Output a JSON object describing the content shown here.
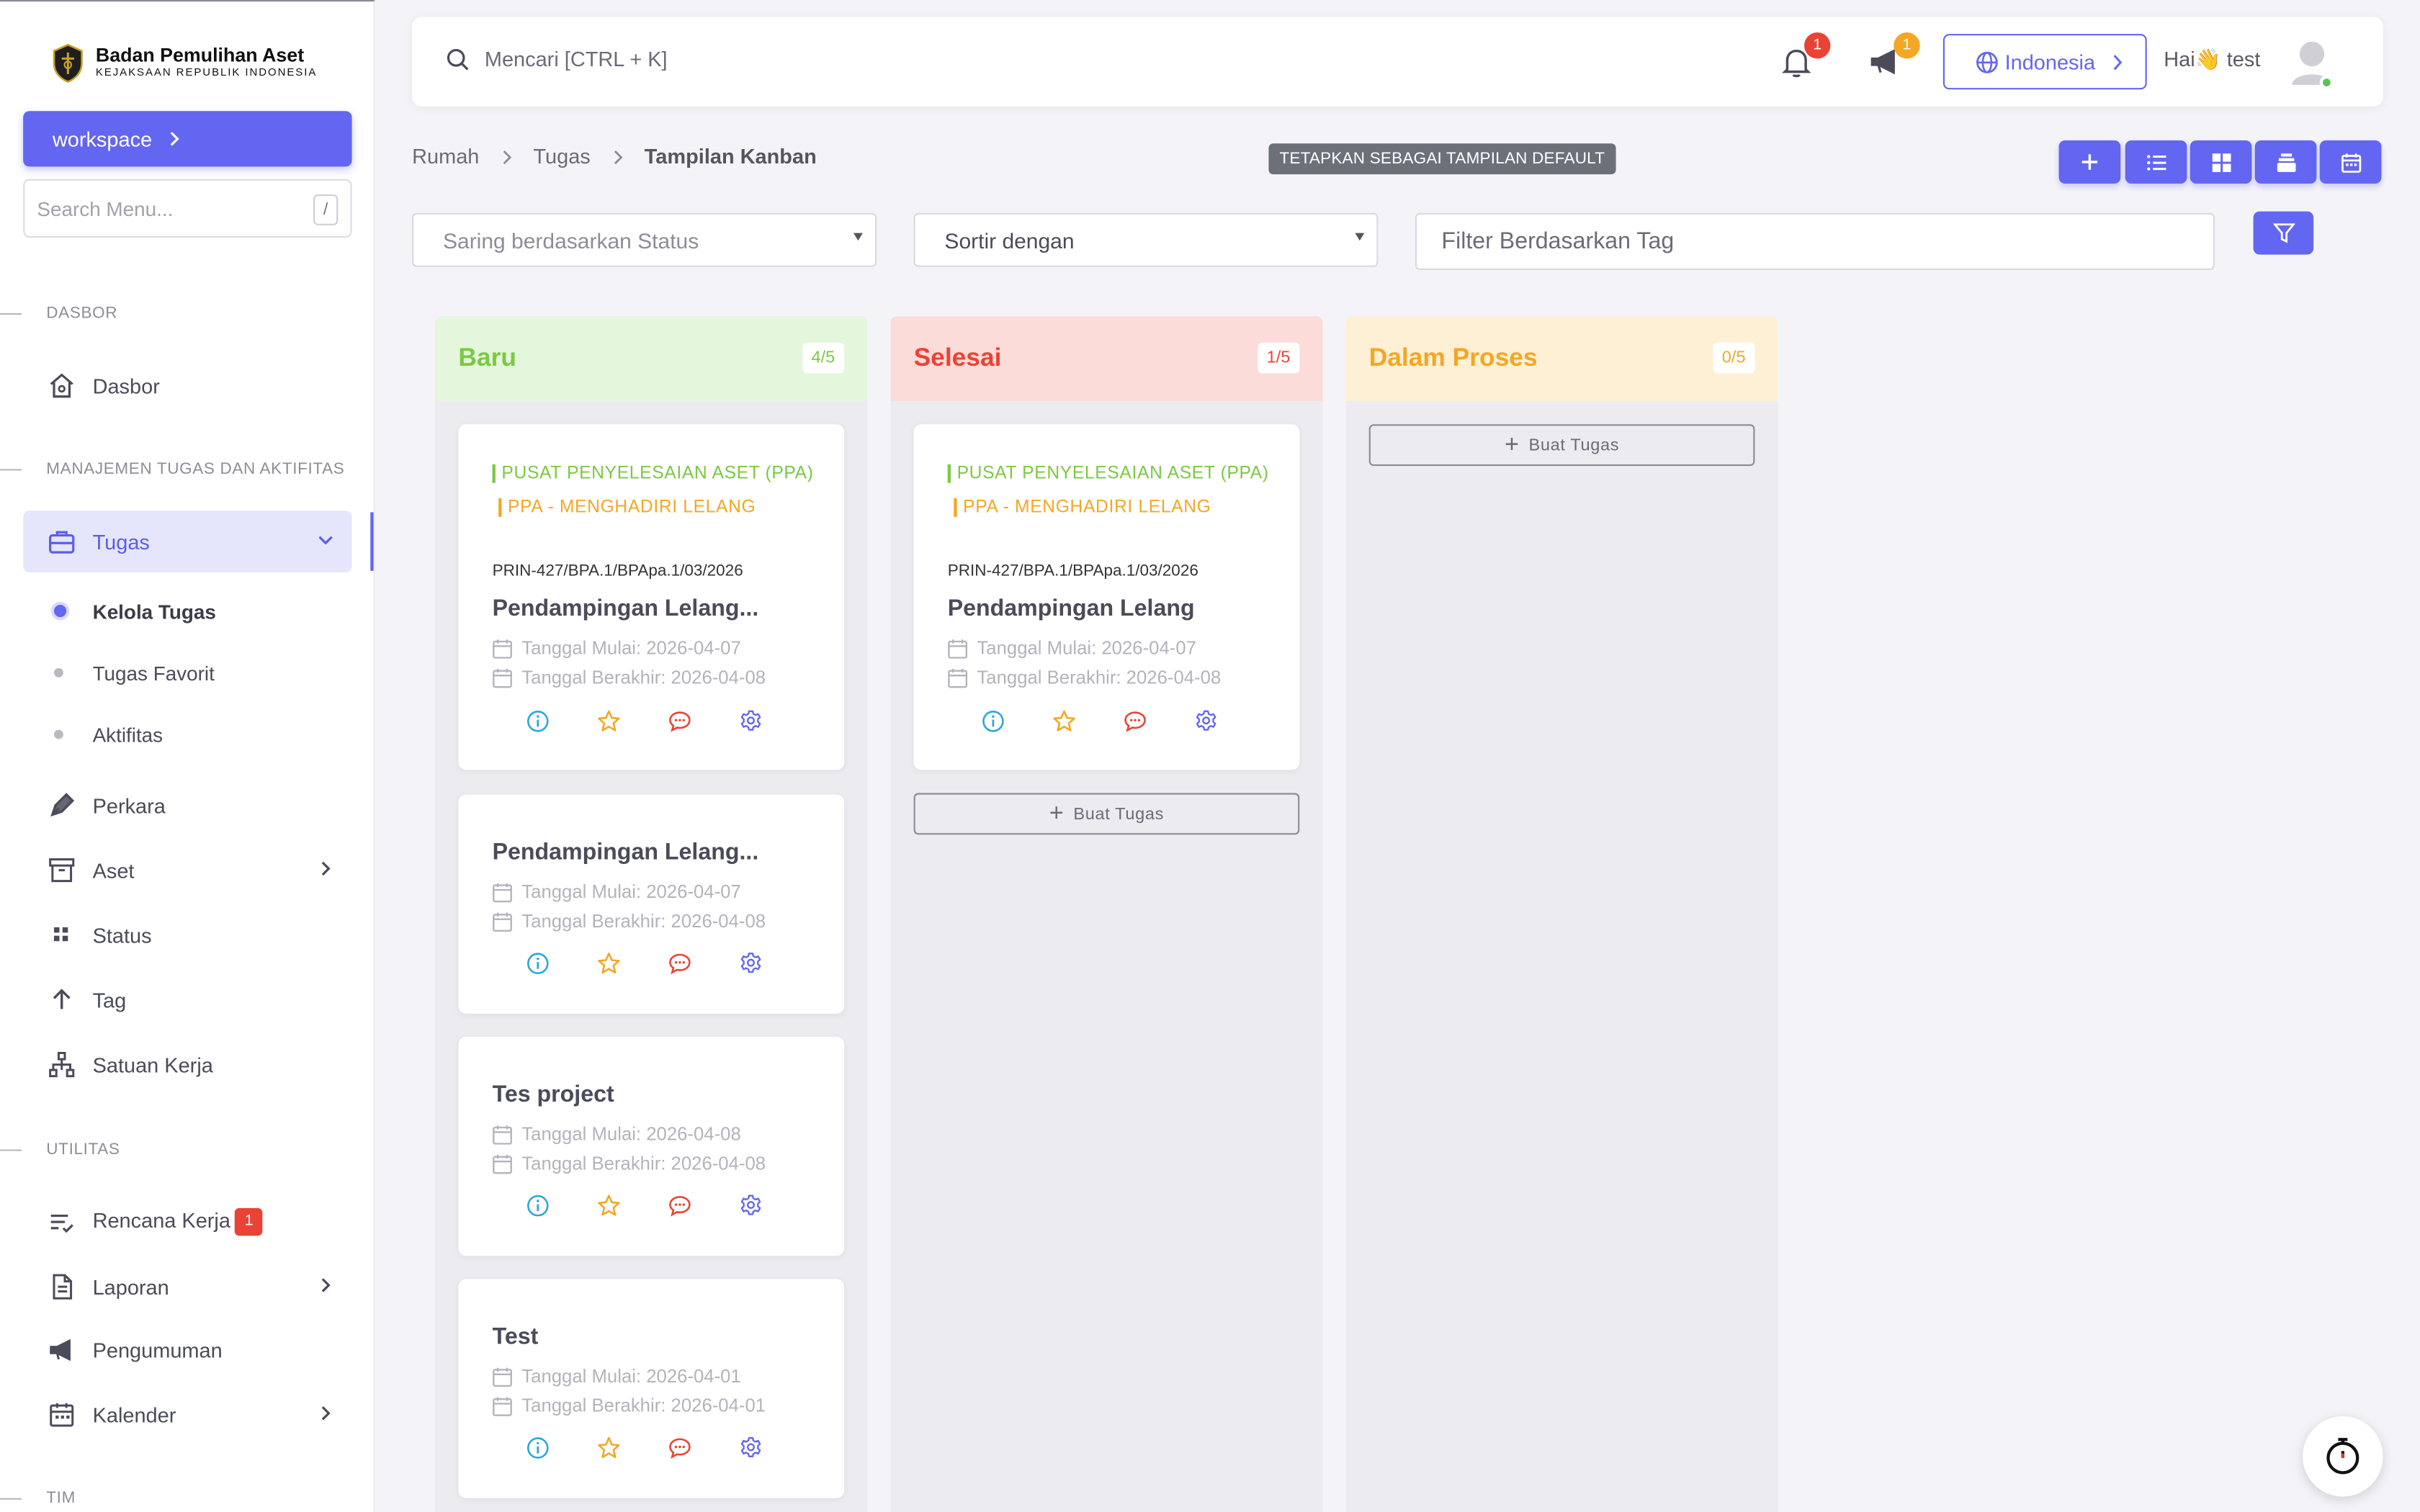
{
  "brand": {
    "name": "Badan Pemulihan Aset",
    "subtitle": "KEJAKSAAN REPUBLIK INDONESIA"
  },
  "sidebar": {
    "workspace_label": "workspace",
    "search_placeholder": "Search Menu...",
    "search_shortcut": "/",
    "sections": {
      "dasbor": "DASBOR",
      "manajemen": "MANAJEMEN TUGAS DAN AKTIFITAS",
      "utilitas": "UTILITAS",
      "tim": "TIM"
    },
    "items": {
      "dasbor": "Dasbor",
      "tugas": "Tugas",
      "kelola_tugas": "Kelola Tugas",
      "tugas_favorit": "Tugas Favorit",
      "aktifitas": "Aktifitas",
      "perkara": "Perkara",
      "aset": "Aset",
      "status": "Status",
      "tag": "Tag",
      "satuan_kerja": "Satuan Kerja",
      "rencana_kerja": "Rencana Kerja",
      "rencana_kerja_badge": "1",
      "laporan": "Laporan",
      "pengumuman": "Pengumuman",
      "kalender": "Kalender"
    }
  },
  "topbar": {
    "search_placeholder": "Mencari [CTRL + K]",
    "notification_count": "1",
    "announcement_count": "1",
    "language": "Indonesia",
    "greeting": "Hai👋 test"
  },
  "breadcrumb": {
    "home": "Rumah",
    "tasks": "Tugas",
    "current": "Tampilan Kanban"
  },
  "default_view_tooltip": "TETAPKAN SEBAGAI TAMPILAN DEFAULT",
  "filters": {
    "status_placeholder": "Saring berdasarkan Status",
    "sort_placeholder": "Sortir dengan",
    "tag_placeholder": "Filter Berdasarkan Tag"
  },
  "columns": [
    {
      "title": "Baru",
      "count": "4/5",
      "cards": [
        {
          "tag1": "PUSAT PENYELESAIAN ASET (PPA)",
          "tag2": "PPA - MENGHADIRI LELANG",
          "code": "PRIN-427/BPA.1/BPApa.1/03/2026",
          "title": "Pendampingan Lelang...",
          "start": "Tanggal Mulai: 2026-04-07",
          "end": "Tanggal Berakhir: 2026-04-08"
        },
        {
          "title": "Pendampingan Lelang...",
          "start": "Tanggal Mulai: 2026-04-07",
          "end": "Tanggal Berakhir: 2026-04-08"
        },
        {
          "title": "Tes project",
          "start": "Tanggal Mulai: 2026-04-08",
          "end": "Tanggal Berakhir: 2026-04-08"
        },
        {
          "title": "Test",
          "start": "Tanggal Mulai: 2026-04-01",
          "end": "Tanggal Berakhir: 2026-04-01"
        }
      ]
    },
    {
      "title": "Selesai",
      "count": "1/5",
      "create_label": "Buat Tugas",
      "cards": [
        {
          "tag1": "PUSAT PENYELESAIAN ASET (PPA)",
          "tag2": "PPA - MENGHADIRI LELANG",
          "code": "PRIN-427/BPA.1/BPApa.1/03/2026",
          "title": "Pendampingan Lelang",
          "start": "Tanggal Mulai: 2026-04-07",
          "end": "Tanggal Berakhir: 2026-04-08"
        }
      ]
    },
    {
      "title": "Dalam Proses",
      "count": "0/5",
      "create_label": "Buat Tugas",
      "cards": []
    }
  ],
  "colors": {
    "primary": "#6366f1",
    "baru": "#7ac943",
    "baru_bg": "#e4f6dc",
    "selesai": "#ea4335",
    "selesai_bg": "#fbdcd8",
    "proses": "#f5a623",
    "proses_bg": "#fdf0d5",
    "info": "#2aa7d8",
    "star": "#f5a623",
    "comment": "#ea4335",
    "settings": "#6366f1"
  }
}
